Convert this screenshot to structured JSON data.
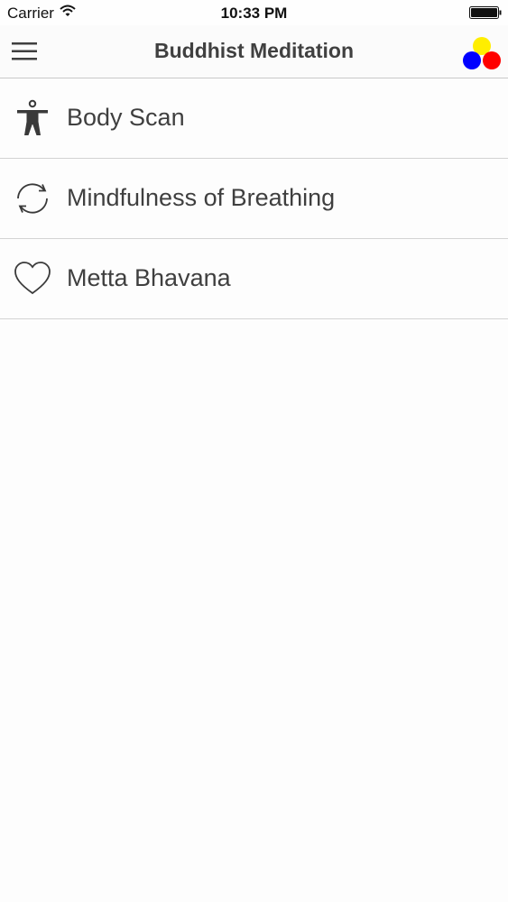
{
  "status_bar": {
    "carrier": "Carrier",
    "time": "10:33 PM",
    "wifi_icon": "wifi-icon",
    "battery_icon": "battery-icon"
  },
  "nav_bar": {
    "title": "Buddhist Meditation",
    "menu_icon": "hamburger-menu-icon",
    "logo_colors": [
      "#ffee00",
      "#0000ff",
      "#ff0000"
    ]
  },
  "list": {
    "items": [
      {
        "label": "Body Scan",
        "icon": "person-icon"
      },
      {
        "label": "Mindfulness of Breathing",
        "icon": "cycle-arrows-icon"
      },
      {
        "label": "Metta Bhavana",
        "icon": "heart-icon"
      }
    ]
  },
  "colors": {
    "text": "#3f3f3f",
    "separator": "#d3d3d3",
    "background": "#fdfdfd"
  }
}
